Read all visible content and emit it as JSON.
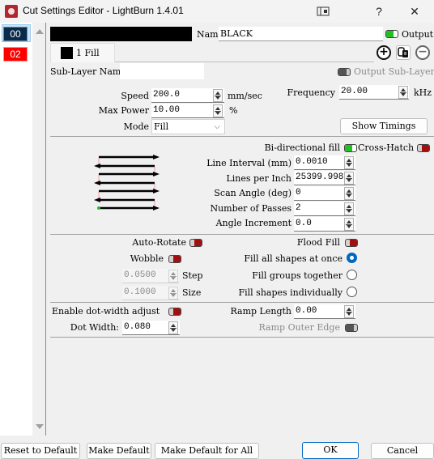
{
  "window": {
    "title": "Cut Settings Editor - LightBurn 1.4.01",
    "help_label": "?",
    "close_label": "✕"
  },
  "layers": [
    {
      "label": "00",
      "color": "#0a2a4a",
      "selected": true
    },
    {
      "label": "02",
      "color": "#ff0000",
      "selected": false
    }
  ],
  "header": {
    "layer_color": "#000000",
    "name_label": "Name",
    "name_value": "BLACK",
    "output_label": "Output",
    "output_on": true
  },
  "sublayer_tab": {
    "label": "1 Fill",
    "color": "#000000"
  },
  "sublayer": {
    "name_label": "Sub-Layer Name",
    "name_value": "",
    "output_sublayer_label": "Output Sub-Layer"
  },
  "actions": {
    "add_icon": "⊕",
    "copy_icon": "copy",
    "remove_icon": "⊖"
  },
  "basic": {
    "speed_label": "Speed",
    "speed_value": "200.0",
    "speed_unit": "mm/sec",
    "power_label": "Max Power",
    "power_value": "10.00",
    "power_unit": "%",
    "mode_label": "Mode",
    "mode_value": "Fill",
    "frequency_label": "Frequency",
    "frequency_value": "20.00",
    "frequency_unit": "kHz",
    "show_timings_label": "Show Timings"
  },
  "fill": {
    "bidir_label": "Bi-directional fill",
    "bidir_on": true,
    "crosshatch_label": "Cross-Hatch",
    "crosshatch_on": false,
    "line_interval_label": "Line Interval (mm)",
    "line_interval_value": "0.0010",
    "lpi_label": "Lines per Inch",
    "lpi_value": "25399.998",
    "scan_angle_label": "Scan Angle (deg)",
    "scan_angle_value": "0",
    "passes_label": "Number of Passes",
    "passes_value": "2",
    "angle_inc_label": "Angle Increment",
    "angle_inc_value": "0.0"
  },
  "options": {
    "auto_rotate_label": "Auto-Rotate",
    "wobble_label": "Wobble",
    "step_value": "0.0500",
    "step_label": "Step",
    "size_value": "0.1000",
    "size_label": "Size",
    "flood_fill_label": "Flood Fill",
    "fill_all_label": "Fill all shapes at once",
    "fill_groups_label": "Fill groups together",
    "fill_individual_label": "Fill shapes individually",
    "fill_selected": "all"
  },
  "dot": {
    "enable_label": "Enable dot-width adjust",
    "width_label": "Dot Width:",
    "width_value": "0.080",
    "ramp_length_label": "Ramp Length",
    "ramp_length_value": "0.00",
    "ramp_outer_label": "Ramp Outer Edge"
  },
  "footer": {
    "reset_label": "Reset to Default",
    "make_default_label": "Make Default",
    "make_default_all_label": "Make Default for All",
    "ok_label": "OK",
    "cancel_label": "Cancel"
  }
}
